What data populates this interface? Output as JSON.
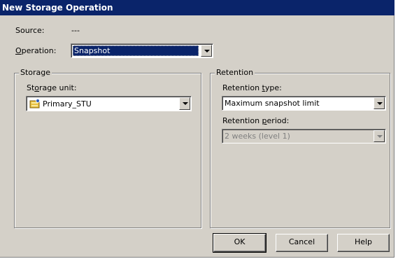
{
  "dialog": {
    "title": "New Storage Operation"
  },
  "source": {
    "label": "Source:",
    "value": "---"
  },
  "operation": {
    "label_prefix": "",
    "label_mnemonic": "O",
    "label_rest": "peration:",
    "selected": "Snapshot"
  },
  "storage": {
    "group_label": "Storage",
    "unit_label_prefix": "St",
    "unit_label_mnemonic": "o",
    "unit_label_rest": "rage unit:",
    "unit_value": "Primary_STU",
    "icon": "storage-unit-icon"
  },
  "retention": {
    "group_label": "Retention",
    "type_label_prefix": "Retention ",
    "type_label_mnemonic": "t",
    "type_label_rest": "ype:",
    "type_value": "Maximum snapshot limit",
    "period_label_prefix": "Retention ",
    "period_label_mnemonic": "p",
    "period_label_rest": "eriod:",
    "period_value": "2 weeks (level 1)",
    "period_enabled": false
  },
  "buttons": {
    "ok": "OK",
    "cancel": "Cancel",
    "help": "Help"
  }
}
